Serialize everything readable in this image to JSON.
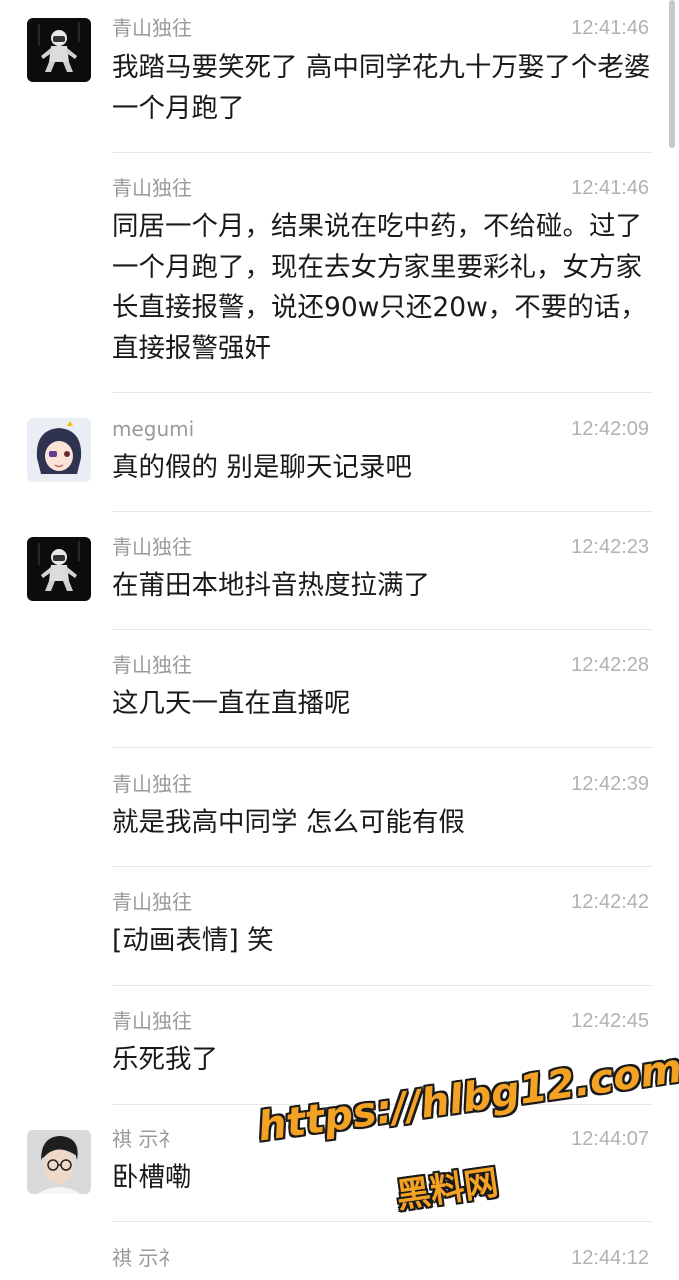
{
  "messages": [
    {
      "sender": "青山独往",
      "time": "12:41:46",
      "text": "我踏马要笑死了 高中同学花九十万娶了个老婆 一个月跑了",
      "avatar": "astronaut-avatar"
    },
    {
      "sender": "青山独往",
      "time": "12:41:46",
      "text": "同居一个月，结果说在吃中药，不给碰。过了一个月跑了，现在去女方家里要彩礼，女方家长直接报警，说还90w只还20w，不要的话，直接报警强奸"
    },
    {
      "sender": "megumi",
      "time": "12:42:09",
      "text": "真的假的  别是聊天记录吧",
      "avatar": "anime-girl-avatar"
    },
    {
      "sender": "青山独往",
      "time": "12:42:23",
      "text": "在莆田本地抖音热度拉满了",
      "avatar": "astronaut-avatar"
    },
    {
      "sender": "青山独往",
      "time": "12:42:28",
      "text": "这几天一直在直播呢"
    },
    {
      "sender": "青山独往",
      "time": "12:42:39",
      "text": "就是我高中同学 怎么可能有假"
    },
    {
      "sender": "青山独往",
      "time": "12:42:42",
      "text": "[动画表情] 笑"
    },
    {
      "sender": "青山独往",
      "time": "12:42:45",
      "text": "乐死我了"
    },
    {
      "sender": "祺 示礻",
      "time": "12:44:07",
      "text": "卧槽嘞",
      "avatar": "young-man-avatar"
    },
    {
      "sender": "祺 示礻",
      "time": "12:44:12",
      "text": ""
    }
  ],
  "watermark": {
    "url": "https://hlbg12.com",
    "name": "黑料网",
    "color": "#f4a223"
  },
  "colors": {
    "sender": "#9a9a9a",
    "time": "#b2b2b2",
    "text": "#1a1a1a",
    "divider": "#e6e6e6"
  }
}
